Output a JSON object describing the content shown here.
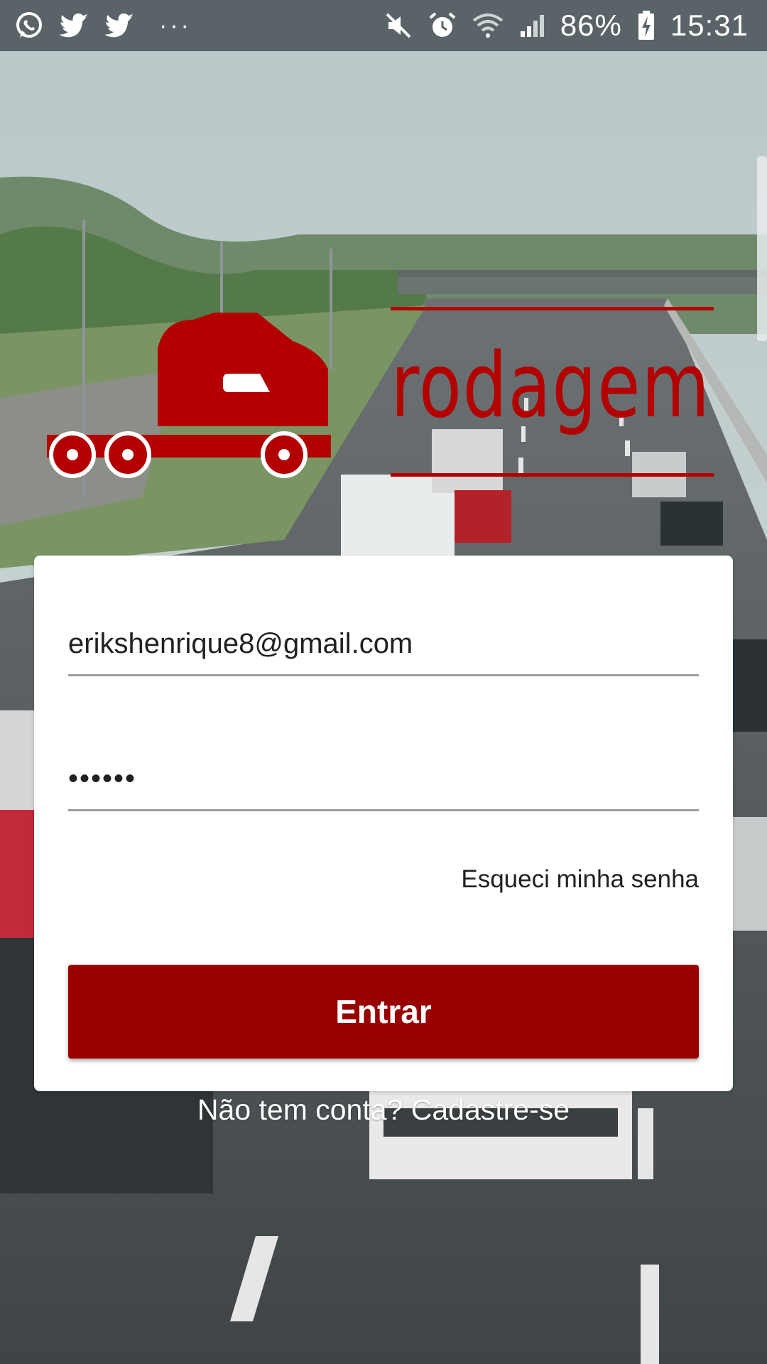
{
  "status_bar": {
    "battery_percent": "86%",
    "time": "15:31",
    "left_icons": [
      "whatsapp-icon",
      "twitter-icon",
      "twitter-icon",
      "more-dots-icon"
    ],
    "right_icons": [
      "mute-icon",
      "alarm-icon",
      "wifi-icon",
      "signal-icon",
      "battery-charging-icon"
    ],
    "overflow_text": "···"
  },
  "logo": {
    "word": "rodagem",
    "color": "#b30000"
  },
  "login": {
    "email_value": "erikshenrique8@gmail.com",
    "password_value": "••••••",
    "forgot_label": "Esqueci minha senha",
    "submit_label": "Entrar",
    "accent_color": "#990000"
  },
  "signup": {
    "prompt": "Não tem conta? ",
    "link": "Cadastre-se"
  }
}
